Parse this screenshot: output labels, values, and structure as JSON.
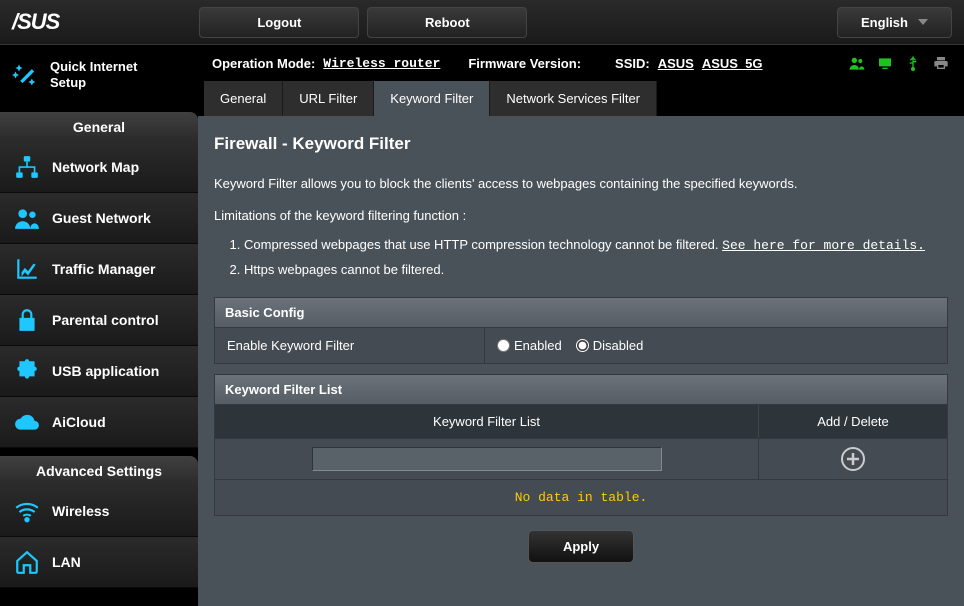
{
  "top": {
    "logout": "Logout",
    "reboot": "Reboot",
    "language": "English"
  },
  "info": {
    "op_mode_label": "Operation Mode:",
    "op_mode_value": "Wireless router",
    "fw_label": "Firmware Version:",
    "ssid_label": "SSID:",
    "ssid1": "ASUS",
    "ssid2": "ASUS_5G"
  },
  "sidebar": {
    "quick_setup_l1": "Quick Internet",
    "quick_setup_l2": "Setup",
    "general_header": "General",
    "advanced_header": "Advanced Settings",
    "general_items": [
      "Network Map",
      "Guest Network",
      "Traffic Manager",
      "Parental control",
      "USB application",
      "AiCloud"
    ],
    "advanced_items": [
      "Wireless",
      "LAN"
    ]
  },
  "tabs": [
    "General",
    "URL Filter",
    "Keyword Filter",
    "Network Services Filter"
  ],
  "active_tab": 2,
  "page": {
    "title": "Firewall - Keyword Filter",
    "description": "Keyword Filter allows you to block the clients' access to webpages containing the specified keywords.",
    "limits_title": "Limitations of the keyword filtering function :",
    "limits": [
      {
        "text": "Compressed webpages that use HTTP compression technology cannot be filtered. ",
        "link": "See here for more details."
      },
      {
        "text": "Https webpages cannot be filtered.",
        "link": ""
      }
    ],
    "basic_config_header": "Basic Config",
    "enable_label": "Enable Keyword Filter",
    "enabled_label": "Enabled",
    "disabled_label": "Disabled",
    "enable_value": "disabled",
    "list_header": "Keyword Filter List",
    "col_list": "Keyword Filter List",
    "col_action": "Add / Delete",
    "no_data": "No data in table.",
    "apply": "Apply"
  }
}
